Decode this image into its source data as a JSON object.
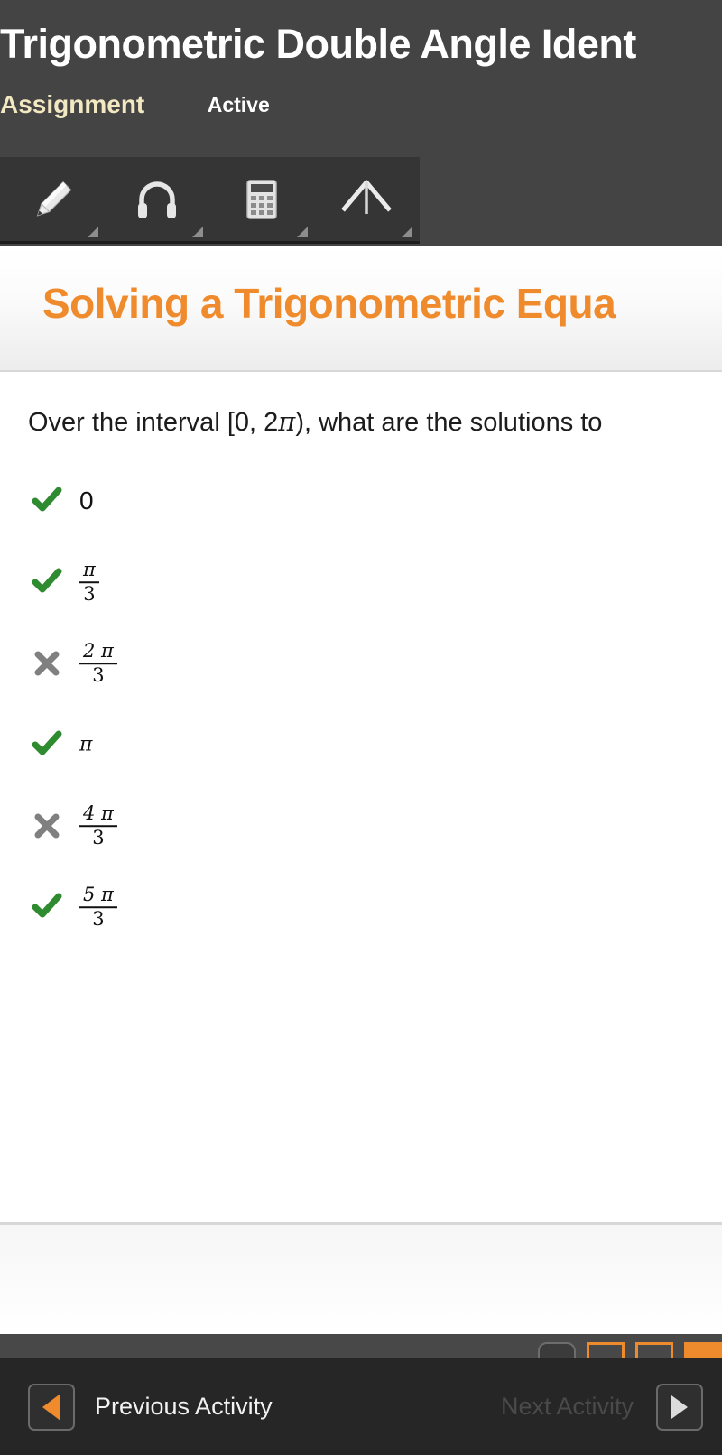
{
  "header": {
    "title": "Trigonometric Double Angle Ident",
    "label_assignment": "Assignment",
    "label_status": "Active"
  },
  "toolbar": {
    "items": [
      {
        "icon": "pencil-icon",
        "name": "annotate-tool"
      },
      {
        "icon": "headphones-icon",
        "name": "audio-tool"
      },
      {
        "icon": "calculator-icon",
        "name": "calculator-tool"
      },
      {
        "icon": "compass-icon",
        "name": "protractor-tool"
      }
    ]
  },
  "lesson": {
    "banner_title": "Solving a Trigonometric Equa"
  },
  "question": {
    "prompt_part1": "Over the interval [0, 2",
    "prompt_pi": "π",
    "prompt_part2": "), what are the solutions to",
    "options": [
      {
        "mark": "check",
        "kind": "plain",
        "value": "0"
      },
      {
        "mark": "check",
        "kind": "fraction",
        "numerator": "π",
        "denominator": "3"
      },
      {
        "mark": "cross",
        "kind": "fraction",
        "numerator": "2 π",
        "denominator": "3"
      },
      {
        "mark": "check",
        "kind": "pi",
        "value": "π"
      },
      {
        "mark": "cross",
        "kind": "fraction",
        "numerator": "4 π",
        "denominator": "3"
      },
      {
        "mark": "check",
        "kind": "fraction",
        "numerator": "5 π",
        "denominator": "3"
      }
    ]
  },
  "nav": {
    "previous_label": "Previous Activity",
    "next_label": "Next Activity"
  },
  "colors": {
    "accent_orange": "#ef8b2c",
    "header_dark": "#444444",
    "navbar_dark": "#262626",
    "correct_green": "#2f8b2f",
    "incorrect_gray": "#808080",
    "assignment_cream": "#f2e8c2"
  }
}
